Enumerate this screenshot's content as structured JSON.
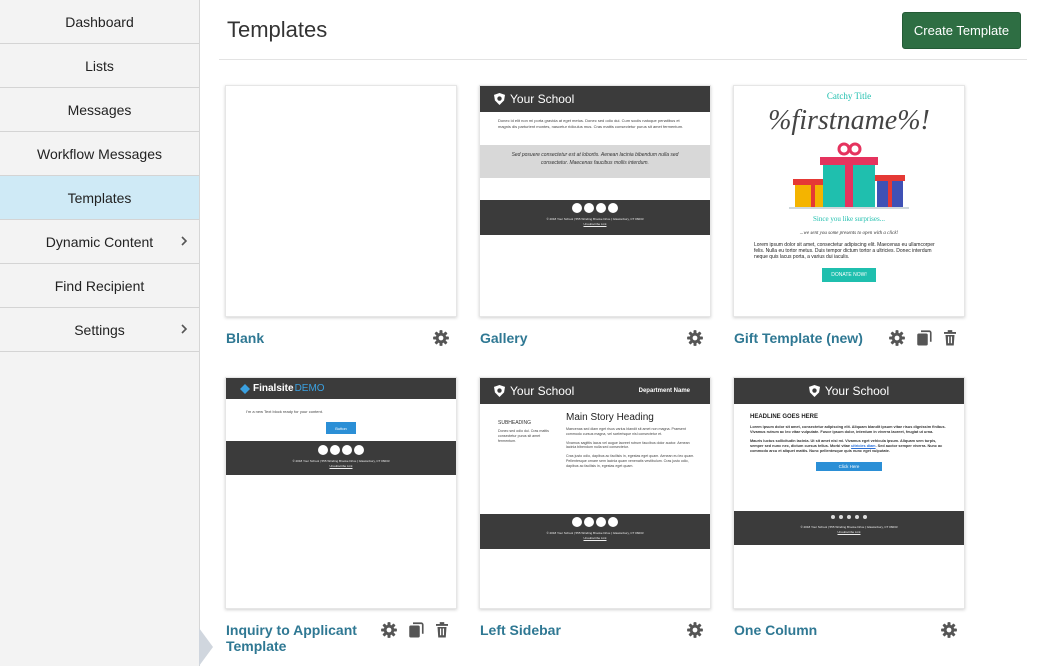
{
  "sidebar": {
    "items": [
      {
        "label": "Dashboard"
      },
      {
        "label": "Lists"
      },
      {
        "label": "Messages"
      },
      {
        "label": "Workflow Messages"
      },
      {
        "label": "Templates",
        "active": true
      },
      {
        "label": "Dynamic Content",
        "has_submenu": true
      },
      {
        "label": "Find Recipient"
      },
      {
        "label": "Settings",
        "has_submenu": true
      }
    ]
  },
  "header": {
    "title": "Templates",
    "create_label": "Create Template"
  },
  "templates": [
    {
      "name": "Blank",
      "actions": [
        "gear-icon"
      ]
    },
    {
      "name": "Gallery",
      "actions": [
        "gear-icon"
      ]
    },
    {
      "name": "Gift Template (new)",
      "actions": [
        "gear-icon",
        "copy-icon",
        "trash-icon"
      ]
    },
    {
      "name": "Inquiry to Applicant Template",
      "actions": [
        "gear-icon",
        "copy-icon",
        "trash-icon"
      ]
    },
    {
      "name": "Left Sidebar",
      "actions": [
        "gear-icon"
      ]
    },
    {
      "name": "One Column",
      "actions": [
        "gear-icon"
      ]
    }
  ],
  "previews": {
    "school": "Your School",
    "dept": "Department Name",
    "gallery_body": "Donec id elit non mi porta gravida at eget metus. Donec sed odio dui. Cum sociis natoque penatibus et magnis dis parturient montes, nascetur ridiculus mus. Cras mattis consectetur purus sit amet fermentum.",
    "gallery_quote": "Sed posuere consectetur est at lobortis. Aenean lacinia bibendum nulla sed consectetur. Maecenas faucibus mollis interdum.",
    "footer_line": "© 2018   Your School   |  555 Winding Brooke Drive   |  Glastonbury, CT 06033",
    "unsubscribe": "Unsubscribe Link",
    "gift_title": "Catchy Title",
    "gift_name": "%firstname%!",
    "gift_since": "Since you like surprises...",
    "gift_sent": "...we sent you some presents to open with a click!",
    "gift_body": "Lorem ipsum dolor sit amet, consectetur adipiscing elit. Maecenas eu ullamcorper felis. Nulla eu tortor metus. Duis tempor dictum tortor a ultricies. Donec interdum neque quis lacus porta, a varius dui iaculis.",
    "gift_button": "DONATE NOW!",
    "finalsite_brand": "Finalsite",
    "finalsite_demo": "DEMO",
    "inquiry_text": "I'm a new Text block ready for your content.",
    "inquiry_button": "Button",
    "ls_subheading": "SUBHEADING",
    "ls_side": "Donec sed odio dui. Cras mattis consectetur purus sit amet fermentum.",
    "ls_heading": "Main Story Heading",
    "ls_p1": "Maecenas sed diam eget risus varius blandit sit amet non magna. Praesent commodo cursus magna, vel scelerisque nisl consectetur et.",
    "ls_p2": "Vivamus sagittis lacus vel augue laoreet rutrum faucibus dolor auctor. Aenean lacinia bibendum nulla sed consectetur.",
    "ls_p3": "Cras justo odio, dapibus ac facilisis in, egestas eget quam. Aenean eu leo quam. Pellentesque ornare sem lacinia quam venenatis vestibulum. Cras justo odio, dapibus ac facilisis in, egestas eget quam.",
    "oc_headline": "HEADLINE GOES HERE",
    "oc_p1": "Lorem ipsum dolor sit amet, consectetur adipiscing elit. Aliquam blandit ipsum vitae risus dignissim finibus. Vivamus rutrum ac leo vitae vulputate. Fusce ipsum dolor, interdum in viverra laoreet, feugiat ut urna.",
    "oc_p2": "Mauris luctus sollicitudin lacinia. Ut sit amet nisi mi. Vivamus eget vehicula ipsum. Aliquam sem turpis, semper sed nunc nec, dictum cursus tellus. Morbi vitae",
    "oc_link": "ultricies diam",
    "oc_p2_end": ". Sed auctor semper viverra. Nunc ac commodo arcu et aliquet mattis. Nunc pellentesque quis nunc eget vulputate.",
    "oc_button": "Click Here"
  },
  "colors": {
    "accent": "#2f7893",
    "create_button": "#2e6e43",
    "active_nav": "#cfeaf6",
    "dark_bar": "#3b3b3b",
    "gift_teal": "#1fbfae",
    "button_blue": "#2b8fd6"
  }
}
